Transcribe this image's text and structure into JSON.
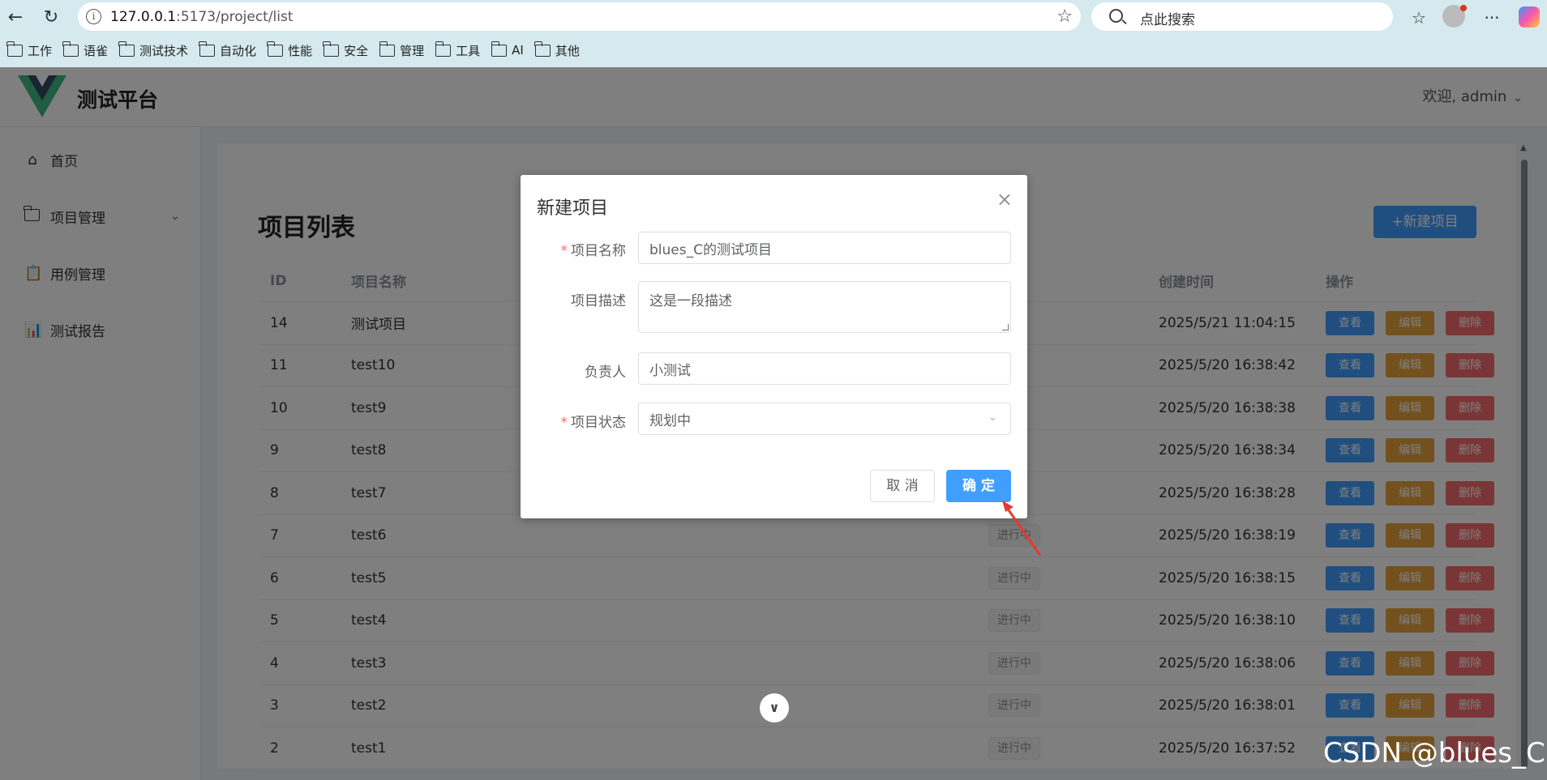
{
  "browser": {
    "url_host": "127.0.0.1",
    "url_rest": ":5173/project/list",
    "search_placeholder": "点此搜索",
    "bookmarks": [
      "工作",
      "语雀",
      "测试技术",
      "自动化",
      "性能",
      "安全",
      "管理",
      "工具",
      "AI",
      "其他"
    ]
  },
  "app": {
    "title": "测试平台",
    "user_greeting": "欢迎, admin"
  },
  "sidebar": {
    "items": [
      {
        "label": "首页",
        "icon": "home-icon"
      },
      {
        "label": "项目管理",
        "icon": "folder-icon"
      },
      {
        "label": "用例管理",
        "icon": "clipboard-icon"
      },
      {
        "label": "测试报告",
        "icon": "report-icon"
      }
    ]
  },
  "page": {
    "title": "项目列表",
    "new_button": "+新建项目"
  },
  "table": {
    "headers": {
      "id": "ID",
      "name": "项目名称",
      "time": "创建时间",
      "op": "操作"
    },
    "actions": {
      "view": "查看",
      "edit": "编辑",
      "delete": "删除"
    },
    "rows": [
      {
        "id": "14",
        "name": "测试项目",
        "status": "",
        "time": "2025/5/21 11:04:15"
      },
      {
        "id": "11",
        "name": "test10",
        "status": "",
        "time": "2025/5/20 16:38:42"
      },
      {
        "id": "10",
        "name": "test9",
        "status": "",
        "time": "2025/5/20 16:38:38"
      },
      {
        "id": "9",
        "name": "test8",
        "status": "",
        "time": "2025/5/20 16:38:34"
      },
      {
        "id": "8",
        "name": "test7",
        "status": "",
        "time": "2025/5/20 16:38:28"
      },
      {
        "id": "7",
        "name": "test6",
        "status": "进行中",
        "time": "2025/5/20 16:38:19"
      },
      {
        "id": "6",
        "name": "test5",
        "status": "进行中",
        "time": "2025/5/20 16:38:15"
      },
      {
        "id": "5",
        "name": "test4",
        "status": "进行中",
        "time": "2025/5/20 16:38:10"
      },
      {
        "id": "4",
        "name": "test3",
        "status": "进行中",
        "time": "2025/5/20 16:38:06"
      },
      {
        "id": "3",
        "name": "test2",
        "status": "进行中",
        "time": "2025/5/20 16:38:01"
      },
      {
        "id": "2",
        "name": "test1",
        "status": "进行中",
        "time": "2025/5/20 16:37:52"
      }
    ]
  },
  "dialog": {
    "title": "新建项目",
    "fields": {
      "name_label": "项目名称",
      "name_value": "blues_C的测试项目",
      "desc_label": "项目描述",
      "desc_value": "这是一段描述",
      "owner_label": "负责人",
      "owner_value": "小测试",
      "status_label": "项目状态",
      "status_value": "规划中"
    },
    "cancel": "取 消",
    "confirm": "确 定"
  },
  "watermark": "CSDN @blues_C",
  "colors": {
    "primary": "#409eff",
    "warning": "#e6a23c",
    "danger": "#f56c6c",
    "annotation_arrow": "#e53935"
  }
}
